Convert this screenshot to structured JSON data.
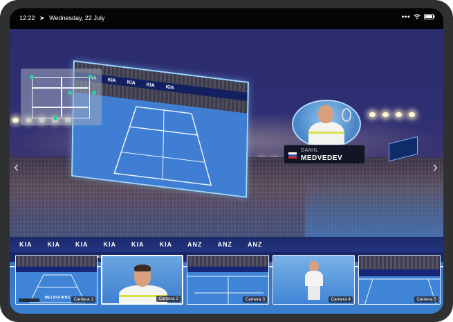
{
  "status_bar": {
    "time": "12:22",
    "date": "Wednesday, 22 July",
    "icons": [
      "location-arrow-icon",
      "signal-dots-icon",
      "wifi-icon",
      "battery-icon"
    ]
  },
  "ads": {
    "brand_main": "KIA",
    "brand_bank": "ANZ",
    "venue_label": "MELBOURNE"
  },
  "player_card": {
    "first_name": "DANIIL",
    "last_name": "MEDVEDEV"
  },
  "cameras": [
    {
      "label": "Camera 1"
    },
    {
      "label": "Camera 2"
    },
    {
      "label": "Camera 3"
    },
    {
      "label": "Camera 4"
    },
    {
      "label": "Camera 5"
    }
  ],
  "colors": {
    "court_blue": "#3f84d6",
    "accent_cyan": "#9fd6ff",
    "minimap_dot": "#2fd0a0"
  }
}
